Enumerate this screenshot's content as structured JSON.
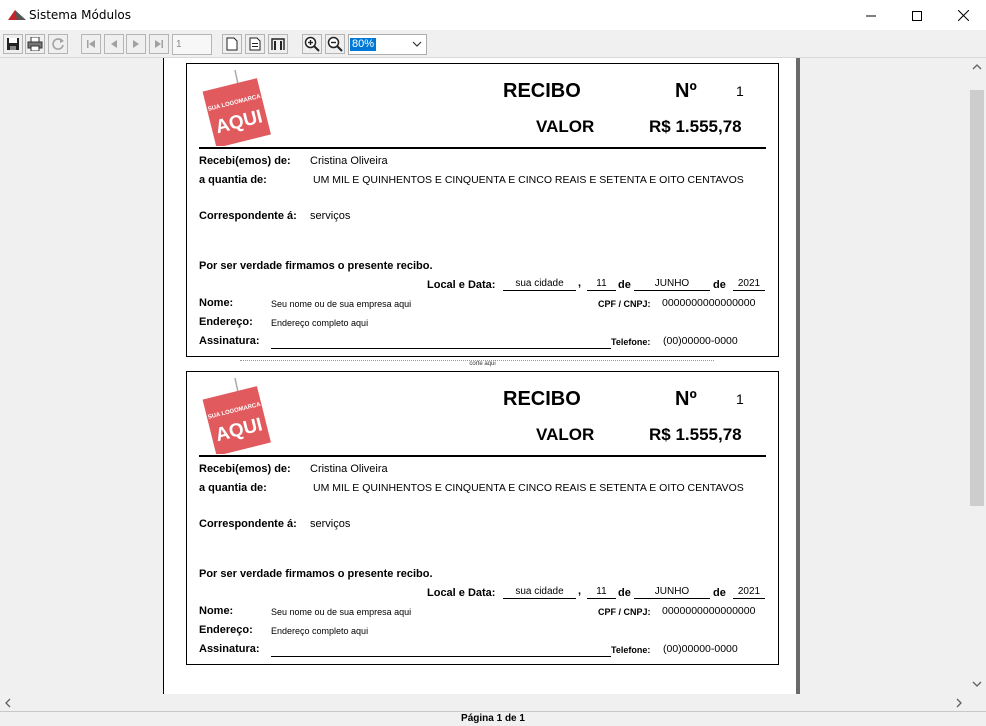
{
  "window": {
    "title": "Sistema Módulos"
  },
  "toolbar": {
    "page_number": "1",
    "zoom": "80%",
    "buttons": [
      "save-icon",
      "print-icon",
      "refresh-icon",
      "first-page-icon",
      "prev-page-icon",
      "next-page-icon",
      "last-page-icon",
      "single-page-icon",
      "page-width-icon",
      "two-pages-icon",
      "zoom-in-icon",
      "zoom-out-icon"
    ]
  },
  "receipt": {
    "logo_line1": "SUA LOGOMARCA",
    "logo_line2": "AQUI",
    "title": "RECIBO",
    "number_label": "Nº",
    "number": "1",
    "value_label": "VALOR",
    "amount": "R$ 1.555,78",
    "received_from_label": "Recebi(emos) de:",
    "received_from": "Cristina Oliveira",
    "quantity_label": "a quantia de:",
    "quantity_words": "UM MIL E QUINHENTOS E CINQUENTA E CINCO REAIS E SETENTA E OITO CENTAVOS",
    "correspondent_label": "Correspondente á:",
    "correspondent": "serviços",
    "truth_statement": "Por ser verdade firmamos o presente recibo.",
    "place_date_label": "Local e Data:",
    "city": "sua cidade",
    "comma": ",",
    "day": "11",
    "de1": "de",
    "month": "JUNHO",
    "de2": "de",
    "year": "2021",
    "name_label": "Nome:",
    "name": "Seu nome ou de sua empresa aqui",
    "cpf_label": "CPF / CNPJ:",
    "cpf": "0000000000000000",
    "address_label": "Endereço:",
    "address": "Endereço completo aqui",
    "signature_label": "Assinatura:",
    "phone_label": "Telefone:",
    "phone": "(00)00000-0000"
  },
  "cut_text": "corte aqui",
  "status": {
    "page_info": "Página 1 de 1"
  },
  "colors": {
    "logo_red": "#e05a5e",
    "zoom_highlight": "#0078d7",
    "page_border": "#6a6a6a"
  }
}
